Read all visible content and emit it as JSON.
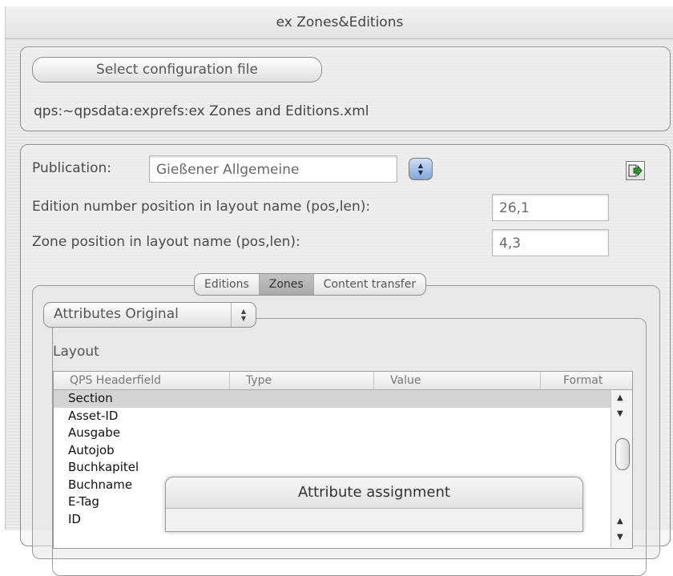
{
  "window": {
    "title": "ex Zones&Editions"
  },
  "file_section": {
    "select_button": "Select configuration file",
    "path": "qps:~qpsdata:exprefs:ex Zones and Editions.xml"
  },
  "config": {
    "publication_label": "Publication:",
    "publication_value": "Gießener Allgemeine",
    "edition_label": "Edition number position in layout name (pos,len):",
    "edition_value": "26,1",
    "zone_label": "Zone position in layout name (pos,len):",
    "zone_value": "4,3",
    "icons": {
      "stepper": "stepper-arrows-icon",
      "export": "export-arrow-icon"
    }
  },
  "tabs": [
    {
      "label": "Editions",
      "selected": false
    },
    {
      "label": "Zones",
      "selected": true
    },
    {
      "label": "Content transfer",
      "selected": false
    }
  ],
  "attributes": {
    "popup_value": "Attributes Original",
    "layout_label": "Layout",
    "columns": [
      "QPS Headerfield",
      "Type",
      "Value",
      "Format"
    ],
    "rows": [
      "Section",
      "Asset-ID",
      "Ausgabe",
      "Autojob",
      "Buchkapitel",
      "Buchname",
      "E-Tag",
      "ID"
    ],
    "selected_row": "Section"
  },
  "dialog": {
    "title": "Attribute assignment"
  }
}
